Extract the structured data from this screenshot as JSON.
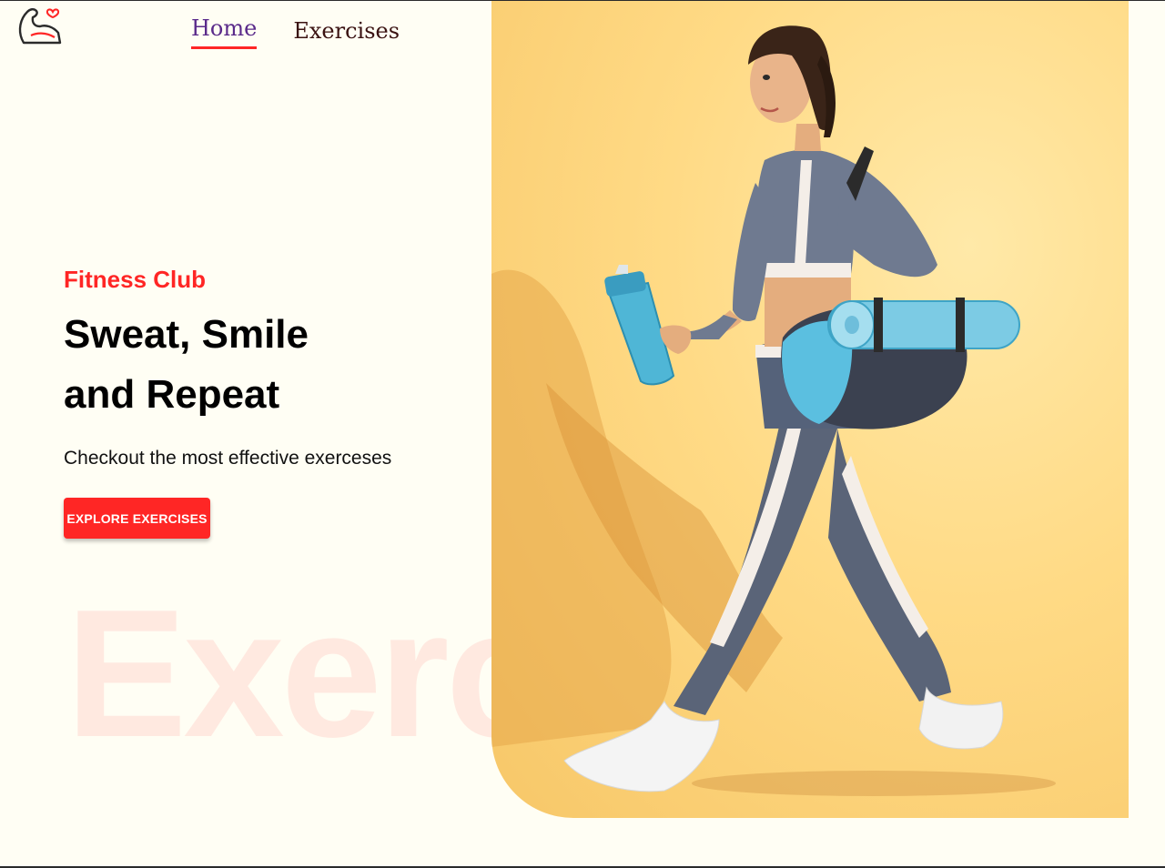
{
  "nav": {
    "items": [
      {
        "label": "Home",
        "active": true
      },
      {
        "label": "Exercises",
        "active": false
      }
    ]
  },
  "hero": {
    "eyebrow": "Fitness Club",
    "headline_line1": "Sweat, Smile",
    "headline_line2": "and Repeat",
    "subtext": "Checkout the most effective exerceses",
    "cta_label": "EXPLORE EXERCISES",
    "watermark": "Exercise"
  },
  "colors": {
    "accent": "#FF2625",
    "page_bg": "#FFFEF4",
    "banner_bg": "#FFD982",
    "nav_active_text": "#5a2a8a",
    "nav_text": "#3A1212"
  },
  "icons": {
    "logo": "flexed-arm-heart-icon"
  },
  "banner_image": "woman-walking-with-shaker-and-yoga-mat"
}
